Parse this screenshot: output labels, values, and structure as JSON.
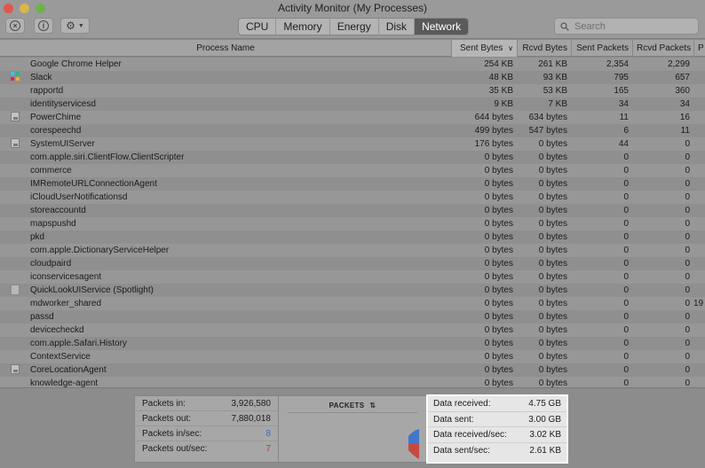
{
  "window": {
    "title": "Activity Monitor (My Processes)"
  },
  "toolbar": {
    "stop_icon": "stop-x-icon",
    "info_icon": "info-icon",
    "gear_icon": "gear-icon",
    "tabs": [
      {
        "label": "CPU",
        "active": false
      },
      {
        "label": "Memory",
        "active": false
      },
      {
        "label": "Energy",
        "active": false
      },
      {
        "label": "Disk",
        "active": false
      },
      {
        "label": "Network",
        "active": true
      }
    ],
    "search": {
      "placeholder": "Search",
      "value": ""
    }
  },
  "table": {
    "columns": {
      "name": "Process Name",
      "sent_bytes": "Sent Bytes",
      "rcvd_bytes": "Rcvd Bytes",
      "sent_packets": "Sent Packets",
      "rcvd_packets": "Rcvd Packets",
      "extra": "P"
    },
    "rows": [
      {
        "icon": "",
        "name": "Google Chrome Helper",
        "sent_bytes": "254 KB",
        "rcvd_bytes": "261 KB",
        "sent_packets": "2,354",
        "rcvd_packets": "2,299",
        "extra": ""
      },
      {
        "icon": "slack",
        "name": "Slack",
        "sent_bytes": "48 KB",
        "rcvd_bytes": "93 KB",
        "sent_packets": "795",
        "rcvd_packets": "657",
        "extra": ""
      },
      {
        "icon": "",
        "name": "rapportd",
        "sent_bytes": "35 KB",
        "rcvd_bytes": "53 KB",
        "sent_packets": "165",
        "rcvd_packets": "360",
        "extra": ""
      },
      {
        "icon": "",
        "name": "identityservicesd",
        "sent_bytes": "9 KB",
        "rcvd_bytes": "7 KB",
        "sent_packets": "34",
        "rcvd_packets": "34",
        "extra": ""
      },
      {
        "icon": "app",
        "name": "PowerChime",
        "sent_bytes": "644 bytes",
        "rcvd_bytes": "634 bytes",
        "sent_packets": "11",
        "rcvd_packets": "16",
        "extra": ""
      },
      {
        "icon": "",
        "name": "corespeechd",
        "sent_bytes": "499 bytes",
        "rcvd_bytes": "547 bytes",
        "sent_packets": "6",
        "rcvd_packets": "11",
        "extra": ""
      },
      {
        "icon": "app",
        "name": "SystemUIServer",
        "sent_bytes": "176 bytes",
        "rcvd_bytes": "0 bytes",
        "sent_packets": "44",
        "rcvd_packets": "0",
        "extra": ""
      },
      {
        "icon": "",
        "name": "com.apple.siri.ClientFlow.ClientScripter",
        "sent_bytes": "0 bytes",
        "rcvd_bytes": "0 bytes",
        "sent_packets": "0",
        "rcvd_packets": "0",
        "extra": ""
      },
      {
        "icon": "",
        "name": "commerce",
        "sent_bytes": "0 bytes",
        "rcvd_bytes": "0 bytes",
        "sent_packets": "0",
        "rcvd_packets": "0",
        "extra": ""
      },
      {
        "icon": "",
        "name": "IMRemoteURLConnectionAgent",
        "sent_bytes": "0 bytes",
        "rcvd_bytes": "0 bytes",
        "sent_packets": "0",
        "rcvd_packets": "0",
        "extra": ""
      },
      {
        "icon": "",
        "name": "iCloudUserNotificationsd",
        "sent_bytes": "0 bytes",
        "rcvd_bytes": "0 bytes",
        "sent_packets": "0",
        "rcvd_packets": "0",
        "extra": ""
      },
      {
        "icon": "",
        "name": "storeaccountd",
        "sent_bytes": "0 bytes",
        "rcvd_bytes": "0 bytes",
        "sent_packets": "0",
        "rcvd_packets": "0",
        "extra": ""
      },
      {
        "icon": "",
        "name": "mapspushd",
        "sent_bytes": "0 bytes",
        "rcvd_bytes": "0 bytes",
        "sent_packets": "0",
        "rcvd_packets": "0",
        "extra": ""
      },
      {
        "icon": "",
        "name": "pkd",
        "sent_bytes": "0 bytes",
        "rcvd_bytes": "0 bytes",
        "sent_packets": "0",
        "rcvd_packets": "0",
        "extra": ""
      },
      {
        "icon": "",
        "name": "com.apple.DictionaryServiceHelper",
        "sent_bytes": "0 bytes",
        "rcvd_bytes": "0 bytes",
        "sent_packets": "0",
        "rcvd_packets": "0",
        "extra": ""
      },
      {
        "icon": "",
        "name": "cloudpaird",
        "sent_bytes": "0 bytes",
        "rcvd_bytes": "0 bytes",
        "sent_packets": "0",
        "rcvd_packets": "0",
        "extra": ""
      },
      {
        "icon": "",
        "name": "iconservicesagent",
        "sent_bytes": "0 bytes",
        "rcvd_bytes": "0 bytes",
        "sent_packets": "0",
        "rcvd_packets": "0",
        "extra": ""
      },
      {
        "icon": "doc",
        "name": "QuickLookUIService (Spotlight)",
        "sent_bytes": "0 bytes",
        "rcvd_bytes": "0 bytes",
        "sent_packets": "0",
        "rcvd_packets": "0",
        "extra": ""
      },
      {
        "icon": "",
        "name": "mdworker_shared",
        "sent_bytes": "0 bytes",
        "rcvd_bytes": "0 bytes",
        "sent_packets": "0",
        "rcvd_packets": "0",
        "extra": "19"
      },
      {
        "icon": "",
        "name": "passd",
        "sent_bytes": "0 bytes",
        "rcvd_bytes": "0 bytes",
        "sent_packets": "0",
        "rcvd_packets": "0",
        "extra": ""
      },
      {
        "icon": "",
        "name": "devicecheckd",
        "sent_bytes": "0 bytes",
        "rcvd_bytes": "0 bytes",
        "sent_packets": "0",
        "rcvd_packets": "0",
        "extra": ""
      },
      {
        "icon": "",
        "name": "com.apple.Safari.History",
        "sent_bytes": "0 bytes",
        "rcvd_bytes": "0 bytes",
        "sent_packets": "0",
        "rcvd_packets": "0",
        "extra": ""
      },
      {
        "icon": "",
        "name": "ContextService",
        "sent_bytes": "0 bytes",
        "rcvd_bytes": "0 bytes",
        "sent_packets": "0",
        "rcvd_packets": "0",
        "extra": ""
      },
      {
        "icon": "app",
        "name": "CoreLocationAgent",
        "sent_bytes": "0 bytes",
        "rcvd_bytes": "0 bytes",
        "sent_packets": "0",
        "rcvd_packets": "0",
        "extra": ""
      },
      {
        "icon": "",
        "name": "knowledge-agent",
        "sent_bytes": "0 bytes",
        "rcvd_bytes": "0 bytes",
        "sent_packets": "0",
        "rcvd_packets": "0",
        "extra": ""
      }
    ]
  },
  "packets": {
    "in_label": "Packets in:",
    "in_value": "3,926,580",
    "out_label": "Packets out:",
    "out_value": "7,880,018",
    "in_sec_label": "Packets in/sec:",
    "in_sec_value": "8",
    "out_sec_label": "Packets out/sec:",
    "out_sec_value": "7"
  },
  "graph": {
    "label": "PACKETS",
    "in_color": "#2f6fd0",
    "out_color": "#c93a2e"
  },
  "data": {
    "received_label": "Data received:",
    "received_value": "4.75 GB",
    "sent_label": "Data sent:",
    "sent_value": "3.00 GB",
    "received_sec_label": "Data received/sec:",
    "received_sec_value": "3.02 KB",
    "sent_sec_label": "Data sent/sec:",
    "sent_sec_value": "2.61 KB"
  }
}
